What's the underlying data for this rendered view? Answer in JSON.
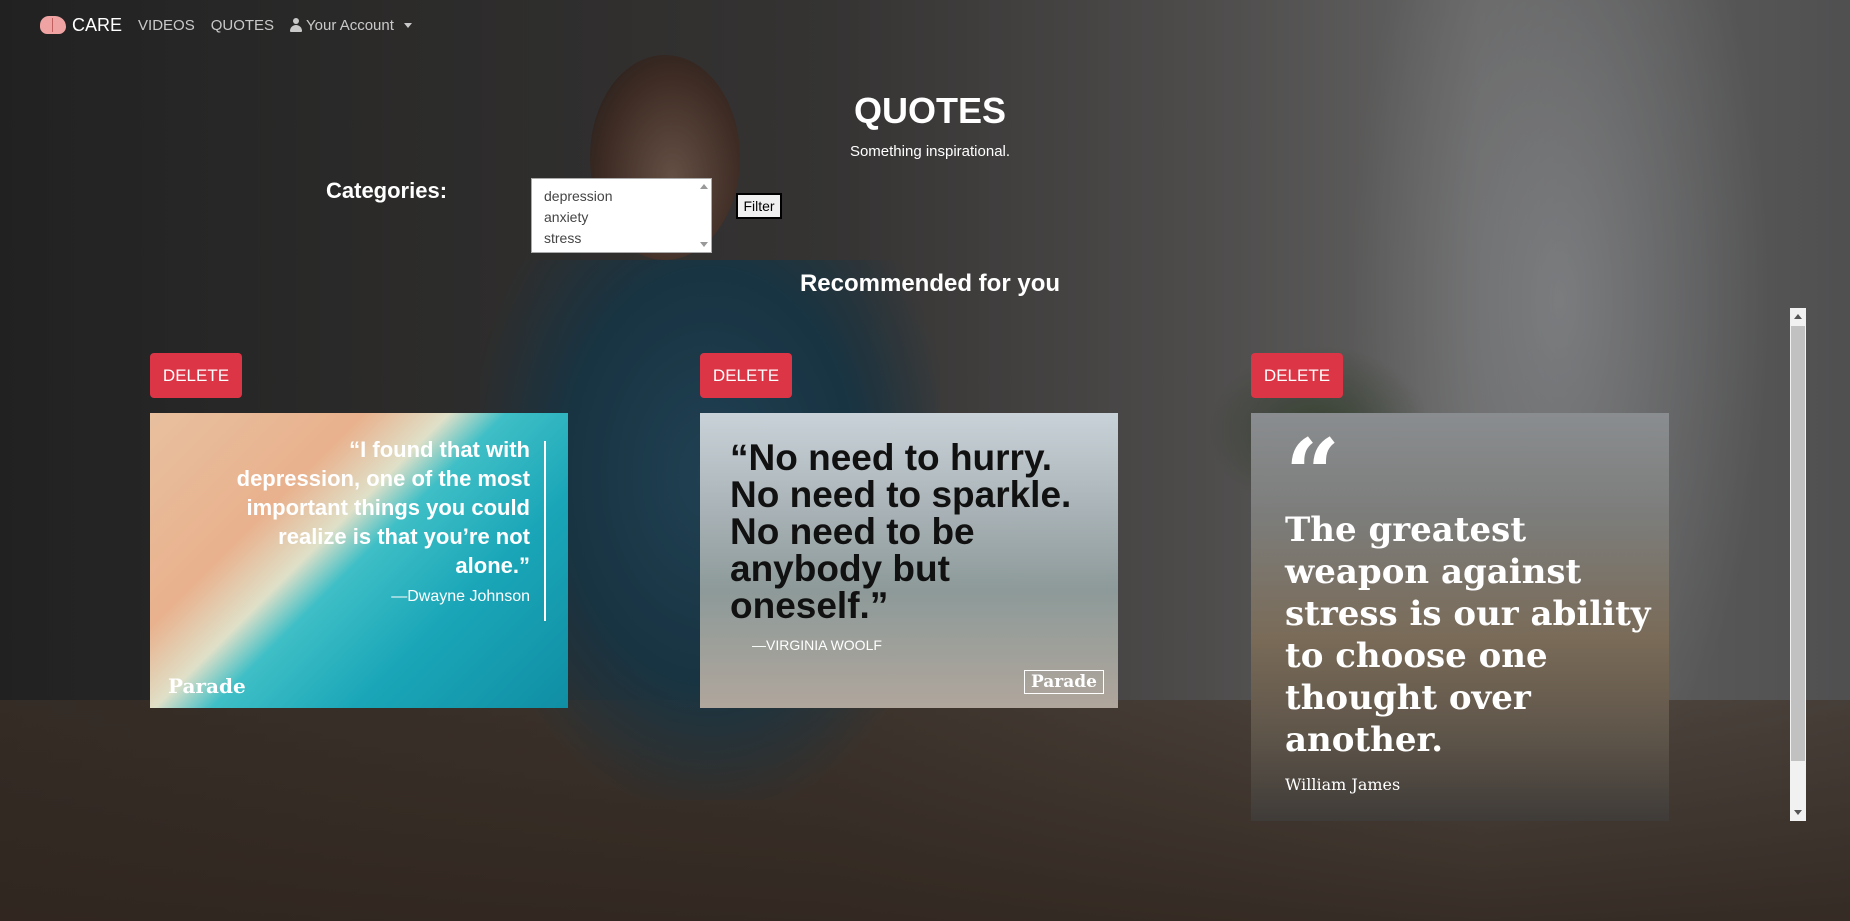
{
  "nav": {
    "brand": "CARE",
    "links": [
      "VIDEOS",
      "QUOTES"
    ],
    "account": "Your Account"
  },
  "page": {
    "title": "QUOTES",
    "subtitle": "Something inspirational.",
    "categories_label": "Categories:",
    "category_options": [
      "depression",
      "anxiety",
      "stress"
    ],
    "filter_label": "Filter",
    "section_title": "Recommended for you"
  },
  "cards": [
    {
      "delete_label": "DELETE",
      "quote": "“I found that with depression, one of the most important things you could realize is that you’re not alone.”",
      "author": "—Dwayne Johnson",
      "source": "Parade"
    },
    {
      "delete_label": "DELETE",
      "quote": "“No need to hurry. No need to sparkle. No need to be anybody but oneself.”",
      "author": "—VIRGINIA WOOLF",
      "source": "Parade"
    },
    {
      "delete_label": "DELETE",
      "quote_mark": "“",
      "quote": "The greatest weapon against stress is our ability to choose one thought over another.",
      "author": "William James"
    }
  ],
  "colors": {
    "delete": "#dc3545",
    "text": "#ffffff"
  }
}
